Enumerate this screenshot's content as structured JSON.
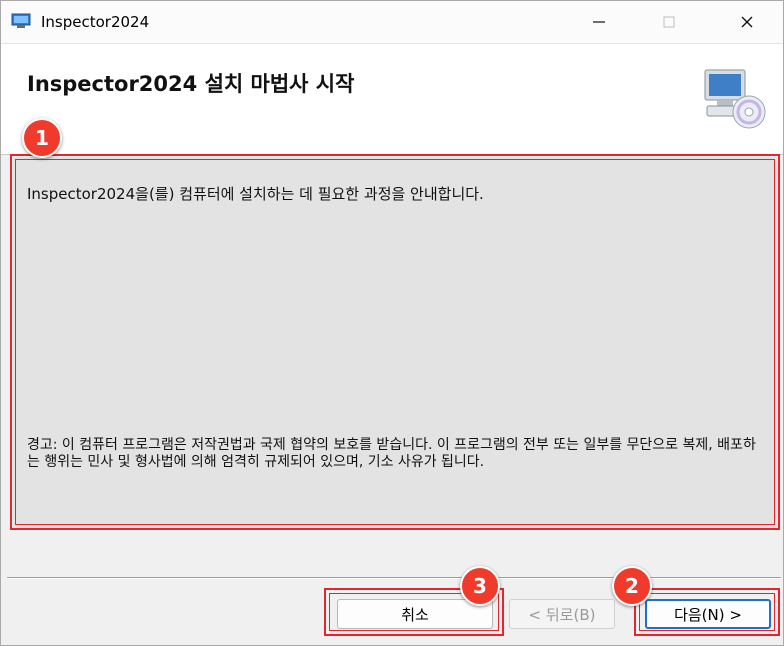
{
  "window": {
    "title": "Inspector2024"
  },
  "header": {
    "title": "Inspector2024 설치 마법사 시작"
  },
  "content": {
    "intro": "Inspector2024을(를) 컴퓨터에 설치하는 데 필요한 과정을 안내합니다.",
    "warning": "경고: 이 컴퓨터 프로그램은 저작권법과 국제 협약의 보호를 받습니다. 이 프로그램의 전부 또는 일부를 무단으로 복제, 배포하는 행위는 민사 및 형사법에 의해 엄격히 규제되어 있으며, 기소 사유가 됩니다."
  },
  "buttons": {
    "cancel": "취소",
    "back": "< 뒤로(B)",
    "next": "다음(N) >"
  },
  "annotations": {
    "badge1": "1",
    "badge2": "2",
    "badge3": "3",
    "color": "#e3262e"
  },
  "icons": {
    "app": "installer-icon",
    "header": "computer-cd-icon"
  }
}
